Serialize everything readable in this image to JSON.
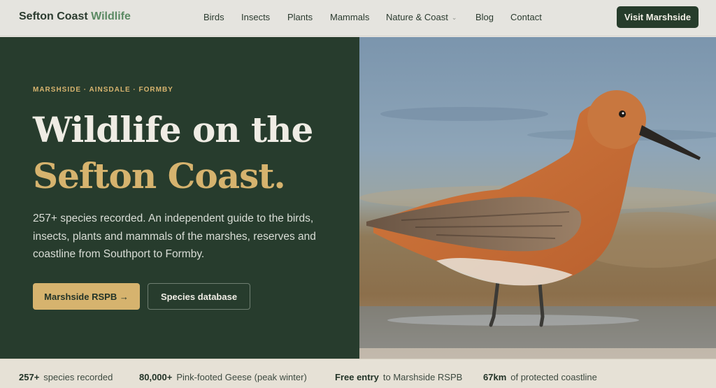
{
  "header": {
    "brand_main": "Sefton Coast",
    "brand_accent": "Wildlife",
    "nav": [
      "Birds",
      "Insects",
      "Plants",
      "Mammals",
      "Nature & Coast",
      "Blog",
      "Contact"
    ],
    "cta": "Visit Marshside"
  },
  "hero": {
    "eyebrow": "MARSHSIDE · AINSDALE · FORMBY",
    "headline_line1": "Wildlife on the",
    "headline_line2": "Sefton Coast.",
    "lede": "257+ species recorded. An independent guide to the birds, insects, plants and mammals of the marshes, reserves and coastline from Southport to Formby.",
    "primary_button": "Marshside RSPB →",
    "secondary_button": "Species database"
  },
  "stats": [
    {
      "value": "257+",
      "label": "species recorded"
    },
    {
      "value": "80,000+",
      "label": "Pink-footed Geese (peak winter)"
    },
    {
      "value": "Free entry",
      "label": "to Marshside RSPB"
    },
    {
      "value": "67km",
      "label": "of protected coastline"
    }
  ],
  "colors": {
    "dark_green": "#273c2d",
    "gold": "#d6b36e",
    "cream": "#efece4"
  }
}
